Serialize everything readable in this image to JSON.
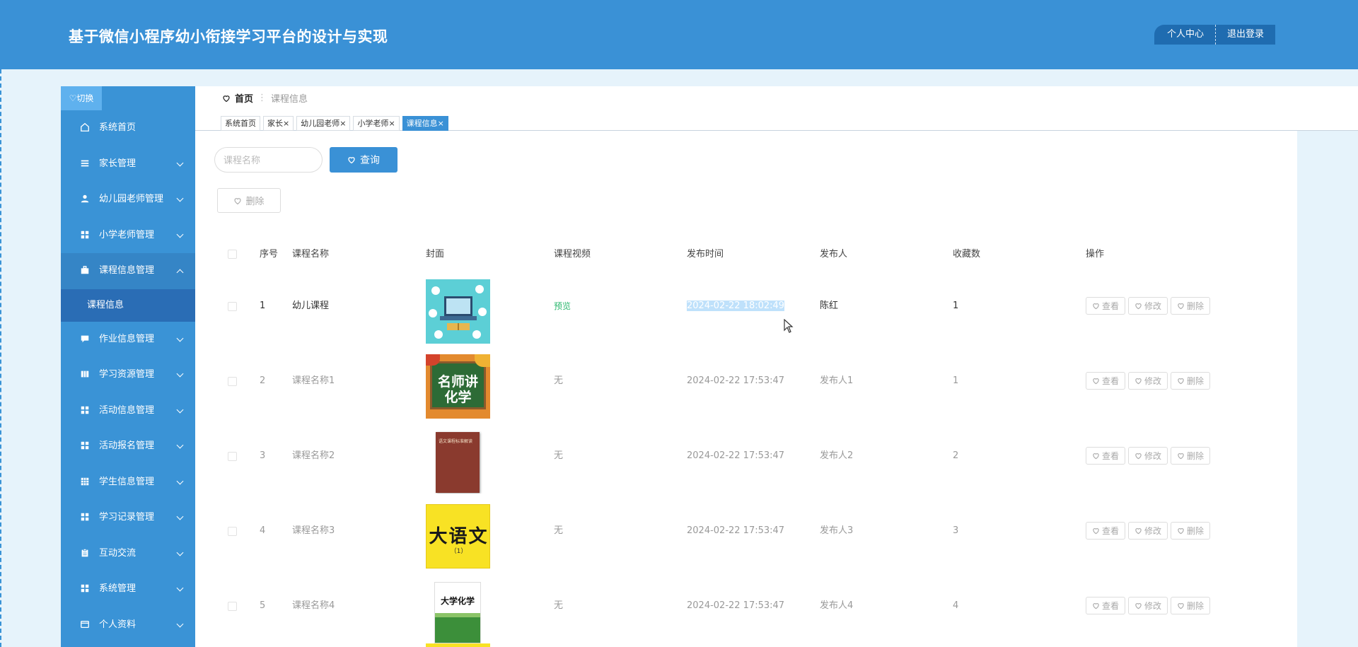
{
  "header": {
    "title": "基于微信小程序幼小衔接学习平台的设计与实现",
    "profile_label": "个人中心",
    "logout_label": "退出登录"
  },
  "sidebar": {
    "toggle_label": "♡切换",
    "items": [
      {
        "label": "系统首页",
        "icon": "home-icon",
        "has_chevron": false
      },
      {
        "label": "家长管理",
        "icon": "list-icon",
        "has_chevron": true
      },
      {
        "label": "幼儿园老师管理",
        "icon": "user-icon",
        "has_chevron": true
      },
      {
        "label": "小学老师管理",
        "icon": "grid-icon",
        "has_chevron": true
      },
      {
        "label": "课程信息管理",
        "icon": "briefcase-icon",
        "has_chevron": true,
        "expanded": true
      },
      {
        "label": "作业信息管理",
        "icon": "comment-icon",
        "has_chevron": true
      },
      {
        "label": "学习资源管理",
        "icon": "book-icon",
        "has_chevron": true
      },
      {
        "label": "活动信息管理",
        "icon": "grid-icon",
        "has_chevron": true
      },
      {
        "label": "活动报名管理",
        "icon": "grid-icon",
        "has_chevron": true
      },
      {
        "label": "学生信息管理",
        "icon": "table-icon",
        "has_chevron": true
      },
      {
        "label": "学习记录管理",
        "icon": "grid-icon",
        "has_chevron": true
      },
      {
        "label": "互动交流",
        "icon": "clipboard-icon",
        "has_chevron": true
      },
      {
        "label": "系统管理",
        "icon": "grid-icon",
        "has_chevron": true
      },
      {
        "label": "个人资料",
        "icon": "card-icon",
        "has_chevron": true
      }
    ],
    "sub_item": "课程信息"
  },
  "breadcrumb": {
    "home": "首页",
    "current": "课程信息"
  },
  "tabs": [
    {
      "label": "系统首页",
      "closable": false,
      "active": false
    },
    {
      "label": "家长",
      "closable": true,
      "active": false
    },
    {
      "label": "幼儿园老师",
      "closable": true,
      "active": false
    },
    {
      "label": "小学老师",
      "closable": true,
      "active": false
    },
    {
      "label": "课程信息",
      "closable": true,
      "active": true
    }
  ],
  "close_glyph": "×",
  "search": {
    "placeholder": "课程名称",
    "query_label": "查询",
    "delete_label": "删除"
  },
  "table": {
    "columns": [
      "序号",
      "课程名称",
      "封面",
      "课程视频",
      "发布时间",
      "发布人",
      "收藏数",
      "操作"
    ],
    "rows": [
      {
        "index": "1",
        "name": "幼儿课程",
        "video": "预览",
        "time": "2024-02-22 18:02:49",
        "publisher": "陈红",
        "favorites": "1",
        "cover": "classroom-laptop"
      },
      {
        "index": "2",
        "name": "课程名称1",
        "video": "无",
        "time": "2024-02-22 17:53:47",
        "publisher": "发布人1",
        "favorites": "1",
        "cover": "chalkboard"
      },
      {
        "index": "3",
        "name": "课程名称2",
        "video": "无",
        "time": "2024-02-22 17:53:47",
        "publisher": "发布人2",
        "favorites": "2",
        "cover": "red-book"
      },
      {
        "index": "4",
        "name": "课程名称3",
        "video": "无",
        "time": "2024-02-22 17:53:47",
        "publisher": "发布人3",
        "favorites": "3",
        "cover": "yellow-book"
      },
      {
        "index": "5",
        "name": "课程名称4",
        "video": "无",
        "time": "2024-02-22 17:53:47",
        "publisher": "发布人4",
        "favorites": "4",
        "cover": "green-book"
      }
    ],
    "actions": {
      "view": "查看",
      "edit": "修改",
      "delete": "删除"
    }
  },
  "cover_art": {
    "chalkboard_text": "名师讲化学",
    "red_book_text": "语文课程标准解读",
    "yellow_book_text": "大语文",
    "yellow_book_sub": "（1）",
    "green_book_text": "大学化学"
  },
  "colors": {
    "primary": "#3a91d6",
    "sidebar": "#3a93d6",
    "sidebar_sub": "#2a6db5",
    "preview_link": "#2db86f"
  }
}
